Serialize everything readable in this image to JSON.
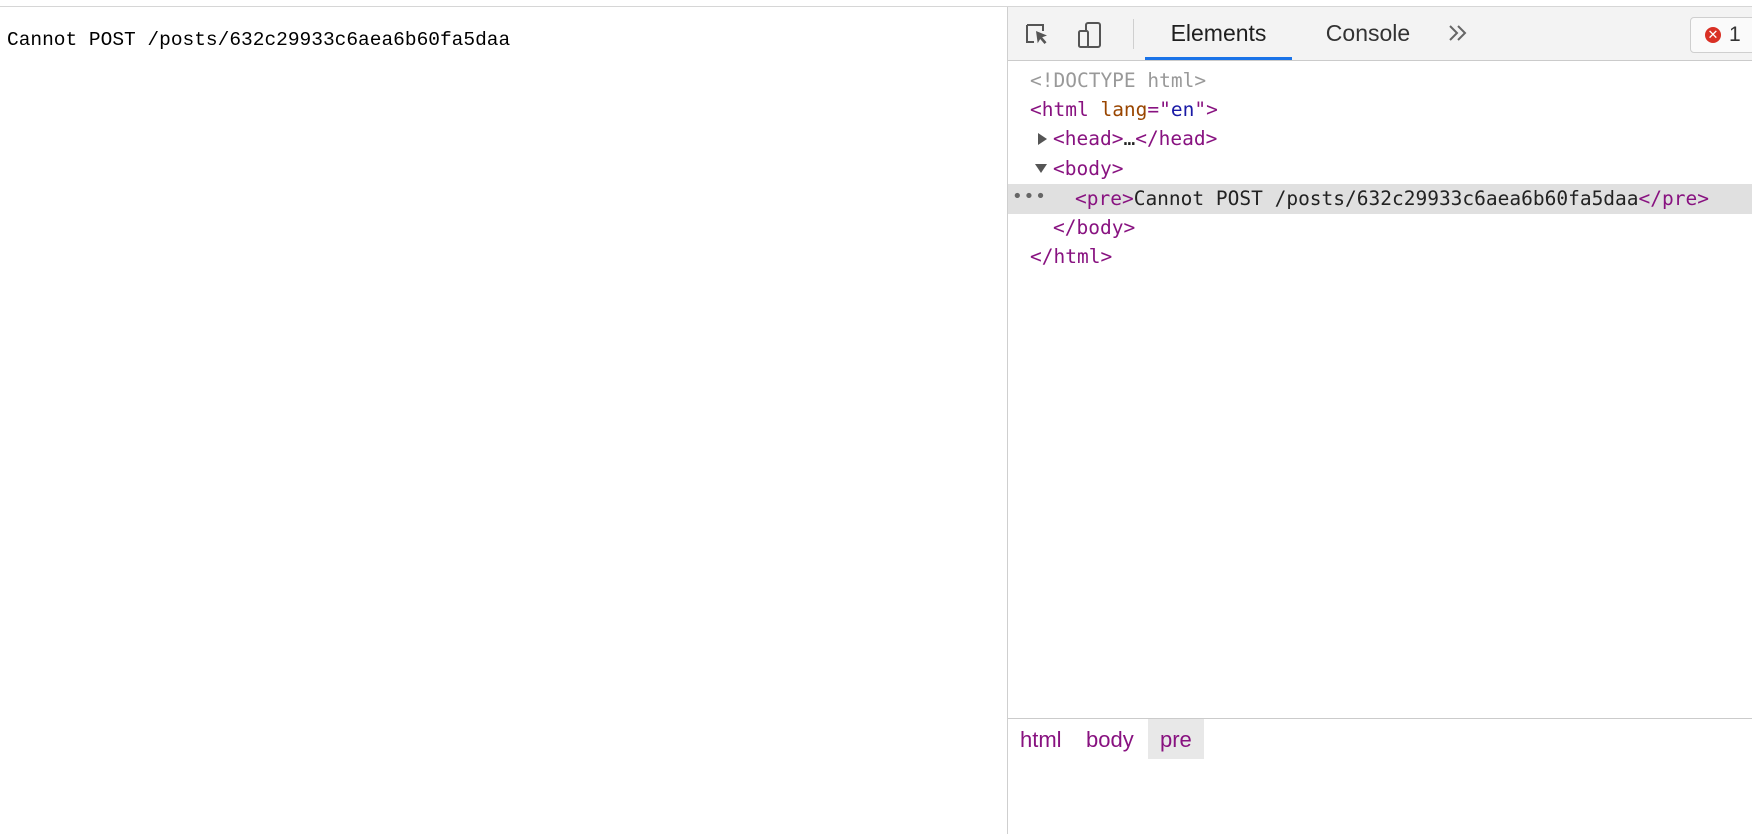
{
  "page": {
    "response_text": "Cannot POST /posts/632c29933c6aea6b60fa5daa"
  },
  "devtools": {
    "tabs": [
      {
        "label": "Elements",
        "active": true
      },
      {
        "label": "Console",
        "active": false
      }
    ],
    "more_tabs_symbol": "»",
    "error_count": "1",
    "error_symbol": "✕",
    "dom": {
      "doctype": "<!DOCTYPE html>",
      "html_open": "<html",
      "lang_attr": "lang",
      "lang_eq": "=\"",
      "lang_val": "en",
      "lang_close": "\">",
      "head_open": "<head>",
      "head_ellipsis": "…",
      "head_close": "</head>",
      "body_open": "<body>",
      "pre_open": "<pre>",
      "pre_text": "Cannot POST /posts/632c29933c6aea6b60fa5daa",
      "pre_close": "</pre>",
      "body_close": "</body>",
      "html_close": "</html>",
      "selected_marker": "•••"
    },
    "breadcrumbs": [
      {
        "label": "html"
      },
      {
        "label": "body"
      },
      {
        "label": "pre"
      }
    ]
  }
}
